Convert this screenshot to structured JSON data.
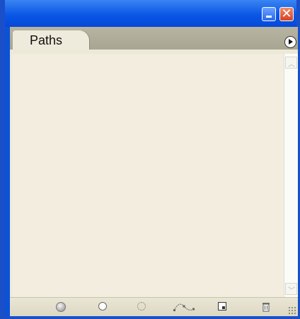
{
  "window": {
    "minimize_icon": "minimize-icon",
    "close_icon": "close-icon",
    "close_glyph": "✕"
  },
  "panel": {
    "tab_label": "Paths",
    "menu_icon": "play-circle-icon"
  },
  "scrollbar": {
    "up_glyph": "︿",
    "down_glyph": "﹀"
  },
  "bottom_tools": [
    {
      "name": "fill-path-icon"
    },
    {
      "name": "stroke-path-icon"
    },
    {
      "name": "load-selection-icon"
    },
    {
      "name": "make-work-path-icon"
    },
    {
      "name": "new-path-icon"
    },
    {
      "name": "delete-path-icon"
    }
  ],
  "colors": {
    "titlebar": "#0a57e6",
    "panel_bg": "#f2edde",
    "close_button": "#d8421e"
  }
}
